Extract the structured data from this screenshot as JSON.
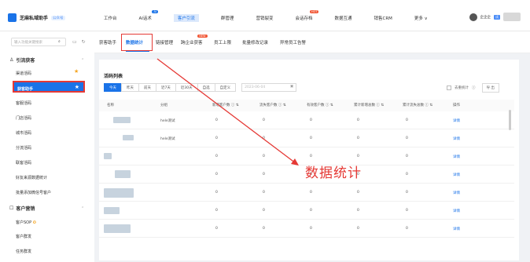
{
  "app": {
    "title": "芝麻私域助手",
    "version": "公众号",
    "brand_color": "#1a73e8"
  },
  "topnav": [
    {
      "label": "工作台"
    },
    {
      "label": "AI话术",
      "badge": "AI"
    },
    {
      "label": "客户引流",
      "active": true
    },
    {
      "label": "群管理"
    },
    {
      "label": "营销裂变"
    },
    {
      "label": "会话存档",
      "badge": "HOT"
    },
    {
      "label": "数据互通"
    },
    {
      "label": "销售CRM"
    },
    {
      "label": "更多 ∨"
    }
  ],
  "user": {
    "name": "企企企",
    "vip": "试"
  },
  "sidebar": {
    "search_placeholder": "输入功能关键搜索",
    "group1": "引流获客",
    "items1": [
      "渠道活码",
      "获客助手",
      "客服活码",
      "门店活码",
      "城市活码",
      "分流活码",
      "联客活码",
      "好友来源数据统计",
      "批量添加微信号客户"
    ],
    "active": "获客助手",
    "group2": "客户营销",
    "items2": [
      "客户SOP",
      "客户群发",
      "任务群发"
    ]
  },
  "tabs": [
    "获客助手",
    "数据统计",
    "链接管理",
    "跨企业获客",
    "员工上限",
    "批量修改记录",
    "异常员工告警"
  ],
  "tab_new_badge": "NEW",
  "panel": {
    "title": "活码列表",
    "filters": [
      "今天",
      "昨天",
      "前天",
      "近7天",
      "近30天",
      "自选",
      "自定义"
    ],
    "date_placeholder": "2023-06-04",
    "dedup": "去重统计",
    "export": "导 出"
  },
  "table": {
    "headers": [
      "名称",
      "分组",
      "新增客户数",
      "流失客户数",
      "有效客户数",
      "累计新增总数",
      "累计流失总数",
      "操作"
    ],
    "rows": [
      {
        "group": "hele测试",
        "v": [
          "0",
          "0",
          "0",
          "0",
          "0"
        ],
        "op": "详情"
      },
      {
        "group": "hele测试",
        "v": [
          "0",
          "0",
          "0",
          "0",
          "0"
        ],
        "op": "详情"
      },
      {
        "group": "",
        "v": [
          "0",
          "0",
          "0",
          "0",
          "0"
        ],
        "op": "详情"
      },
      {
        "group": "",
        "v": [
          "0",
          "0",
          "0",
          "0",
          "0"
        ],
        "op": "详情"
      },
      {
        "group": "",
        "v": [
          "0",
          "0",
          "0",
          "0",
          "0"
        ],
        "op": "详情"
      },
      {
        "group": "",
        "v": [
          "0",
          "0",
          "0",
          "0",
          "0"
        ],
        "op": "详情"
      },
      {
        "group": "",
        "v": [
          "0",
          "0",
          "0",
          "0",
          "0"
        ],
        "op": "详情"
      }
    ]
  },
  "annotation": {
    "text": "数据统计",
    "color": "#e53935"
  }
}
